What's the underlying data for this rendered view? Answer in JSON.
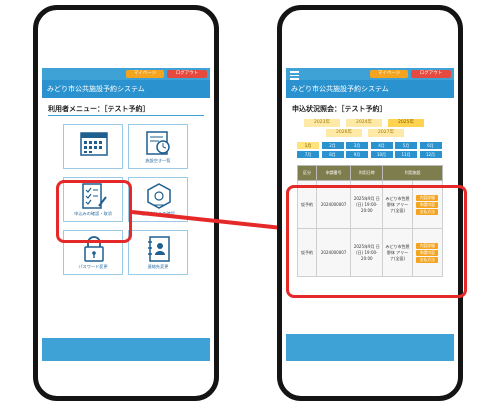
{
  "header": {
    "mypage_label": "マイページ",
    "logout_label": "ログアウト",
    "system_title": "みどり市公共施設予約システム"
  },
  "left": {
    "menu_title": "利用者メニュー：［テスト予約］",
    "menu": [
      {
        "label": "",
        "icon": "calendar-icon"
      },
      {
        "label": "施設空き一覧",
        "icon": "facility-search-icon"
      },
      {
        "label": "申込みの確認・取消",
        "icon": "checklist-icon"
      },
      {
        "label": "抽選申込みの確認",
        "icon": "lottery-icon"
      },
      {
        "label": "パスワード変更",
        "icon": "lock-icon"
      },
      {
        "label": "連絡先変更",
        "icon": "contact-book-icon"
      }
    ]
  },
  "right": {
    "section_title": "申込状況照会：［テスト予約］",
    "years_row1": [
      "2023年",
      "2024年",
      "2025年"
    ],
    "years_row2": [
      "2026年",
      "2027年"
    ],
    "months": [
      "1月",
      "2月",
      "3月",
      "4月",
      "5月",
      "6月",
      "7月",
      "8月",
      "9月",
      "10月",
      "11月",
      "12月"
    ],
    "table": {
      "headers": [
        "区分",
        "申請番号",
        "利用日時",
        "利用施設"
      ],
      "rows": [
        {
          "kind": "仮予約",
          "number": "2024000007",
          "datetime": "2025年9月 日(日) 19:00-20:00",
          "facility": "みどり市笠懸 野体 アリーナ(全面)",
          "actions": [
            "内容詳細",
            "申請内容",
            "支払方法"
          ]
        },
        {
          "kind": "仮予約",
          "number": "2024000007",
          "datetime": "2025年9月 日(日) 19:00-20:00",
          "facility": "みどり市笠懸 野体 アリーナ(全面)",
          "actions": [
            "内容詳細",
            "申請内容",
            "支払方法"
          ]
        }
      ]
    }
  },
  "colors": {
    "header_blue": "#3fa2d6",
    "title_blue": "#2a93cf",
    "highlight_red": "#e52828",
    "button_orange": "#f4a41f",
    "selected_year_yellow": "#ffe27a"
  }
}
